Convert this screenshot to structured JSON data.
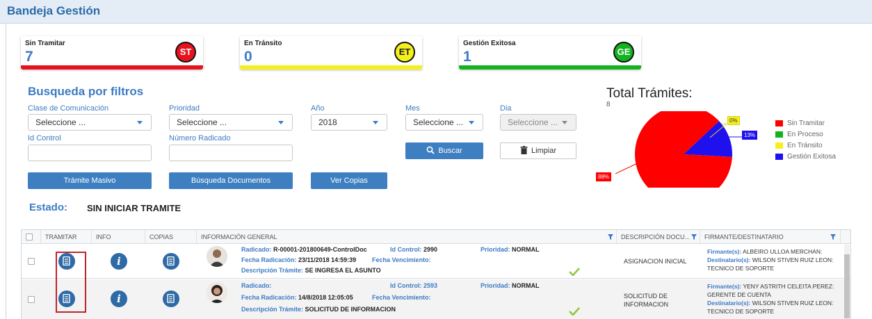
{
  "page": {
    "title": "Bandeja Gestión"
  },
  "cards": [
    {
      "title": "Sin Tramitar",
      "count": "7",
      "badge": "ST",
      "bar_color": "#e8121e",
      "badge_bg": "#e8121e",
      "badge_fg": "#ffffff"
    },
    {
      "title": "En Tránsito",
      "count": "0",
      "badge": "ET",
      "bar_color": "#f4f01c",
      "badge_bg": "#f4f01c",
      "badge_fg": "#222222"
    },
    {
      "title": "Gestión Exitosa",
      "count": "1",
      "badge": "GE",
      "bar_color": "#12b31e",
      "badge_bg": "#12b31e",
      "badge_fg": "#ffffff"
    }
  ],
  "filters": {
    "title": "Busqueda por filtros",
    "clase": {
      "label": "Clase de Comunicación",
      "value": "Seleccione ..."
    },
    "prioridad": {
      "label": "Prioridad",
      "value": "Seleccione ..."
    },
    "anio": {
      "label": "Año",
      "value": "2018"
    },
    "mes": {
      "label": "Mes",
      "value": "Seleccione ..."
    },
    "dia": {
      "label": "Dia",
      "value": "Seleccione ..."
    },
    "id_control": {
      "label": "Id Control"
    },
    "numero_radicado": {
      "label": "Número Radicado"
    },
    "buscar": "Buscar",
    "limpiar": "Limpiar",
    "tramite_masivo": "Trámite Masivo",
    "busqueda_documentos": "Búsqueda Documentos",
    "ver_copias": "Ver Copias"
  },
  "estado": {
    "label": "Estado:",
    "value": "SIN INICIAR TRAMITE"
  },
  "chart_data": {
    "type": "pie",
    "title": "Total Trámites:",
    "subtitle": "8",
    "slices": [
      {
        "name": "Sin Tramitar",
        "value": 88,
        "label": "88%",
        "color": "#ff0000"
      },
      {
        "name": "En Proceso",
        "value": 0,
        "label": "",
        "color": "#12b31e"
      },
      {
        "name": "En Tránsito",
        "value": 0,
        "label": "0%",
        "color": "#f4f01c"
      },
      {
        "name": "Gestión Exitosa",
        "value": 13,
        "label": "13%",
        "color": "#1f10ee"
      }
    ],
    "legend_position": "right"
  },
  "table": {
    "headers": [
      "TRAMITAR",
      "INFO",
      "COPIAS",
      "INFORMACIÓN GENERAL",
      "DESCRIPCIÓN DOCU...",
      "FIRMANTE/DESTINATARIO"
    ],
    "labels": {
      "radicado": "Radicado:",
      "id_control": "Id Control:",
      "prioridad": "Prioridad:",
      "fecha_radicacion": "Fecha Radicación:",
      "fecha_vencimiento": "Fecha Vencimiento:",
      "descripcion_tramite": "Descripción Trámite:",
      "firmantes": "Firmante(s):",
      "destinatarios": "Destinatario(s):"
    },
    "rows": [
      {
        "radicado": "R-00001-201800649-ControlDoc",
        "id_control": "2990",
        "prioridad": "NORMAL",
        "fecha_radicacion": "23/11/2018 14:59:39",
        "fecha_vencimiento": "",
        "descripcion_tramite": "SE INGRESA EL ASUNTO",
        "descripcion_doc": "ASIGNACION INICIAL",
        "firmante": "ALBEIRO ULLOA MERCHAN:",
        "destinatario": "WILSON STIVEN RUIZ LEON: TECNICO DE SOPORTE"
      },
      {
        "radicado": "",
        "id_control": "2593",
        "prioridad": "NORMAL",
        "fecha_radicacion": "14/8/2018 12:05:05",
        "fecha_vencimiento": "",
        "descripcion_tramite": "SOLICITUD DE INFORMACION",
        "descripcion_doc": "SOLICITUD DE INFORMACION",
        "firmante": "YENY ASTRITH CELEITA PEREZ: GERENTE DE CUENTA",
        "destinatario": "WILSON STIVEN RUIZ LEON: TECNICO DE SOPORTE"
      }
    ]
  }
}
